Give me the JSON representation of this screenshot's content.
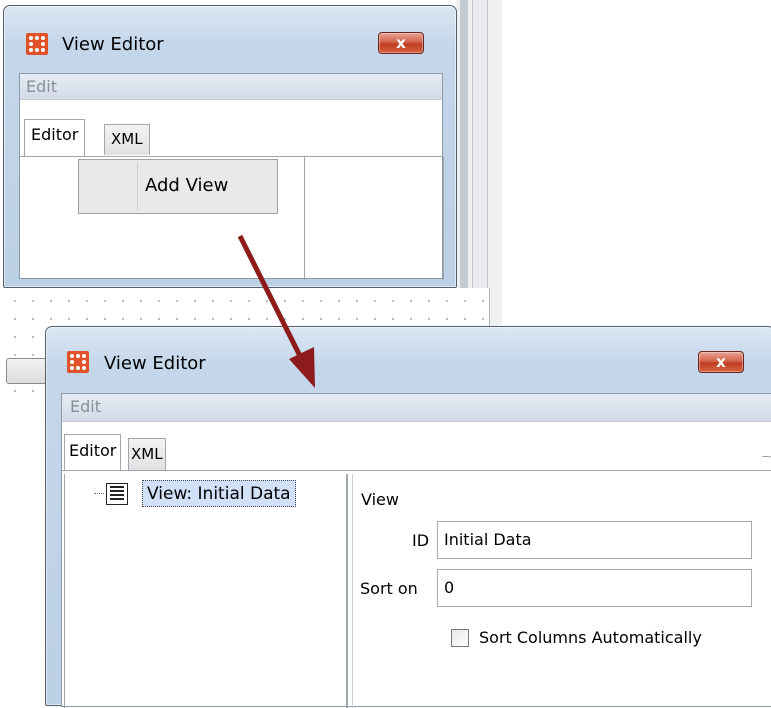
{
  "background": {
    "accent_color": "#aeb4bb"
  },
  "window_back": {
    "title": "View Editor",
    "close_label": "x",
    "menu": [
      "Edit"
    ],
    "tabs": [
      {
        "label": "Editor",
        "active": true
      },
      {
        "label": "XML",
        "active": false
      }
    ],
    "add_view_label": "Add View",
    "app_icon": "app-grid-icon"
  },
  "window_front": {
    "title": "View Editor",
    "close_label": "x",
    "menu": [
      "Edit"
    ],
    "tabs": [
      {
        "label": "Editor",
        "active": true
      },
      {
        "label": "XML",
        "active": false
      }
    ],
    "tree": {
      "items": [
        {
          "label": "View: Initial Data",
          "icon": "document-list-icon",
          "selected": true
        }
      ]
    },
    "properties": {
      "section_label": "View",
      "id_label": "ID",
      "id_value": "Initial Data",
      "sort_label": "Sort on",
      "sort_value": "0",
      "sort_columns_label": "Sort Columns Automatically",
      "sort_columns_checked": false
    }
  },
  "colors": {
    "arrow": "#8e1b1b",
    "close_button": "#c9462b",
    "selection": "#cfe0f7",
    "title_bar": "#bcd0e6"
  }
}
